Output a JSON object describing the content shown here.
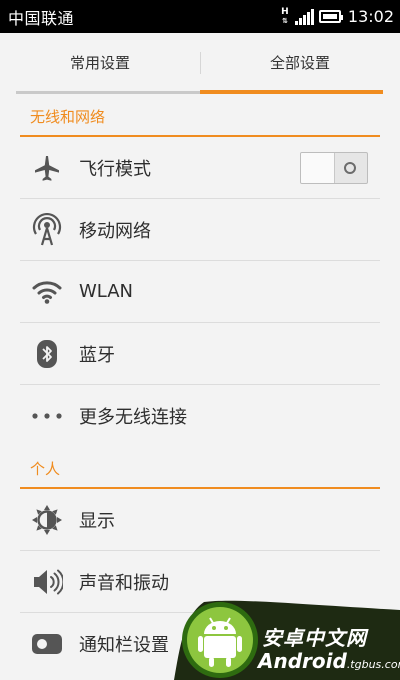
{
  "status_bar": {
    "carrier": "中国联通",
    "network_type": "H",
    "time": "13:02"
  },
  "tabs": [
    {
      "label": "常用设置",
      "selected": false
    },
    {
      "label": "全部设置",
      "selected": true
    }
  ],
  "sections": [
    {
      "title": "无线和网络",
      "items": [
        {
          "label": "飞行模式",
          "icon": "airplane-icon",
          "toggle": false
        },
        {
          "label": "移动网络",
          "icon": "cell-tower-icon"
        },
        {
          "label": "WLAN",
          "icon": "wifi-icon"
        },
        {
          "label": "蓝牙",
          "icon": "bluetooth-icon"
        },
        {
          "label": "更多无线连接",
          "icon": "more-dots-icon"
        }
      ]
    },
    {
      "title": "个人",
      "items": [
        {
          "label": "显示",
          "icon": "brightness-icon"
        },
        {
          "label": "声音和振动",
          "icon": "speaker-icon"
        },
        {
          "label": "通知栏设置",
          "icon": "notification-bar-icon"
        }
      ]
    }
  ],
  "watermark": {
    "site_name": "安卓中文网",
    "brand": "Android",
    "domain": ".tgbus.com"
  },
  "colors": {
    "accent": "#f08c1f",
    "icon": "#555555",
    "text": "#2e2e2e",
    "background": "#f3f3f3"
  }
}
